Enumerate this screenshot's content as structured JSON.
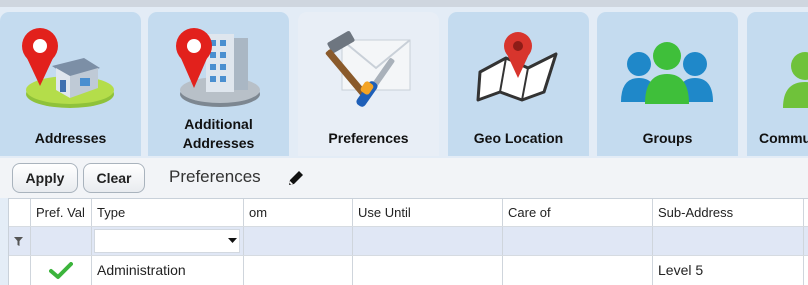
{
  "tabs": [
    {
      "label_line1": "Addresses",
      "label_line2": "",
      "icon": "house-pin-icon",
      "active": false
    },
    {
      "label_line1": "Additional",
      "label_line2": "Addresses",
      "icon": "building-pin-icon",
      "active": false
    },
    {
      "label_line1": "Preferences",
      "label_line2": "",
      "icon": "tools-envelope-icon",
      "active": true
    },
    {
      "label_line1": "Geo Location",
      "label_line2": "",
      "icon": "map-pin-icon",
      "active": false
    },
    {
      "label_line1": "Groups",
      "label_line2": "",
      "icon": "people-group-icon",
      "active": false
    },
    {
      "label_line1": "Commu",
      "label_line2": "",
      "icon": "person-green-icon",
      "active": false
    }
  ],
  "toolbar": {
    "apply_label": "Apply",
    "clear_label": "Clear",
    "title": "Preferences",
    "edit_icon": "pencil-icon"
  },
  "grid": {
    "columns": [
      "",
      "Pref. Val",
      "Type",
      "om",
      "Use Until",
      "Care of",
      "Sub-Address"
    ],
    "filter_icon": "filter-icon",
    "rows": [
      {
        "pref_val": "check-icon",
        "type": "Administration",
        "from": "",
        "use_until": "",
        "care_of": "",
        "sub_address": "Level 5"
      }
    ]
  },
  "colors": {
    "tab": "#c4dbef",
    "tab_active": "#e8eef6",
    "filter_row": "#e0e7f5",
    "check": "#3cb43c"
  }
}
